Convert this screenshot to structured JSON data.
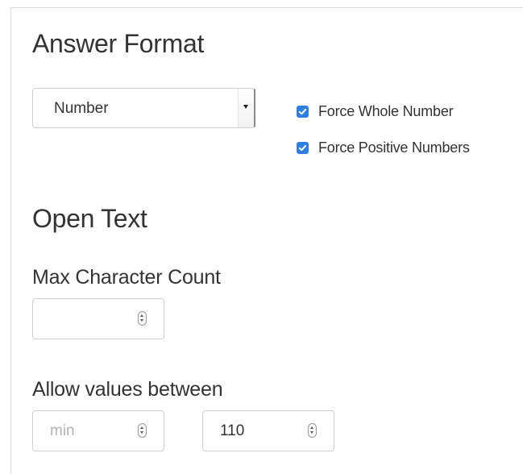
{
  "answer_format": {
    "title": "Answer Format",
    "select": {
      "value": "Number",
      "icon": "chevron-down-icon"
    },
    "options": [
      {
        "label": "Force Whole Number",
        "checked": true
      },
      {
        "label": "Force Positive Numbers",
        "checked": true
      }
    ]
  },
  "open_text": {
    "title": "Open Text",
    "max_char": {
      "label": "Max Character Count",
      "value": ""
    },
    "range": {
      "label": "Allow values between",
      "min_placeholder": "min",
      "min_value": "",
      "max_value": "110"
    }
  },
  "colors": {
    "checkbox_accent": "#2f7ee6",
    "text": "#333333",
    "placeholder": "#b3b3b3",
    "border": "#cfcfcf"
  }
}
